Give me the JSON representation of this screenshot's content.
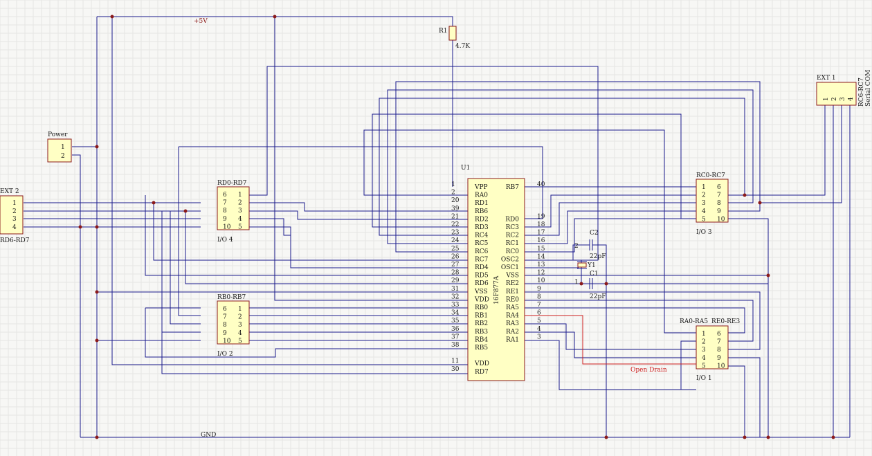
{
  "colors": {
    "wire": "#1a1a8c",
    "wire_alt": "#cc1d1d",
    "part_fill": "#ffffc4",
    "part_border": "#8b1a1a",
    "background": "#f7f7f5"
  },
  "nets": {
    "vcc": "+5V",
    "gnd": "GND",
    "open_drain": "Open Drain"
  },
  "u1": {
    "designator": "U1",
    "part": "16F877A",
    "left_pins": [
      {
        "num": "1",
        "name": "VPP"
      },
      {
        "num": "2",
        "name": "RA0"
      },
      {
        "num": "20",
        "name": "RD1"
      },
      {
        "num": "39",
        "name": "RB6"
      },
      {
        "num": "21",
        "name": "RD2"
      },
      {
        "num": "22",
        "name": "RD3"
      },
      {
        "num": "23",
        "name": "RC4"
      },
      {
        "num": "24",
        "name": "RC5"
      },
      {
        "num": "25",
        "name": "RC6"
      },
      {
        "num": "26",
        "name": "RC7"
      },
      {
        "num": "27",
        "name": "RD4"
      },
      {
        "num": "28",
        "name": "RD5"
      },
      {
        "num": "29",
        "name": "RD6"
      },
      {
        "num": "31",
        "name": "VSS"
      },
      {
        "num": "32",
        "name": "VDD"
      },
      {
        "num": "33",
        "name": "RB0"
      },
      {
        "num": "34",
        "name": "RB1"
      },
      {
        "num": "35",
        "name": "RB2"
      },
      {
        "num": "36",
        "name": "RB3"
      },
      {
        "num": "37",
        "name": "RB4"
      },
      {
        "num": "38",
        "name": "RB5"
      },
      {
        "num": "",
        "name": ""
      },
      {
        "num": "11",
        "name": "VDD"
      },
      {
        "num": "30",
        "name": "RD7"
      }
    ],
    "right_pins": [
      {
        "num": "40",
        "name": "RB7"
      },
      {
        "num": "",
        "name": ""
      },
      {
        "num": "",
        "name": ""
      },
      {
        "num": "",
        "name": ""
      },
      {
        "num": "19",
        "name": "RD0"
      },
      {
        "num": "18",
        "name": "RC3"
      },
      {
        "num": "17",
        "name": "RC2"
      },
      {
        "num": "16",
        "name": "RC1"
      },
      {
        "num": "15",
        "name": "RC0"
      },
      {
        "num": "14",
        "name": "OSC2"
      },
      {
        "num": "13",
        "name": "OSC1"
      },
      {
        "num": "12",
        "name": "VSS"
      },
      {
        "num": "10",
        "name": "RE2"
      },
      {
        "num": "9",
        "name": "RE1"
      },
      {
        "num": "8",
        "name": "RE0"
      },
      {
        "num": "7",
        "name": "RA5"
      },
      {
        "num": "6",
        "name": "RA4"
      },
      {
        "num": "5",
        "name": "RA3"
      },
      {
        "num": "4",
        "name": "RA2"
      },
      {
        "num": "3",
        "name": "RA1"
      }
    ]
  },
  "r1": {
    "designator": "R1",
    "value": "4.7K"
  },
  "c1": {
    "designator": "C1",
    "value": "22pF"
  },
  "c2": {
    "designator": "C2",
    "value": "22pF"
  },
  "y1": {
    "designator": "Y1",
    "pin1": "1",
    "pin2": "2"
  },
  "power": {
    "title": "Power",
    "pins": [
      "1",
      "2"
    ]
  },
  "ext2": {
    "title": "EXT 2",
    "pins": [
      "1",
      "2",
      "3",
      "4"
    ],
    "caption": "RD6-RD7"
  },
  "ext1": {
    "title": "EXT 1",
    "pins": [
      "1",
      "2",
      "3",
      "4"
    ],
    "caption1": "RC6-RC7",
    "caption2": "Serial COM"
  },
  "io4": {
    "title": "RD0-RD7",
    "left": [
      "6",
      "7",
      "8",
      "9",
      "10"
    ],
    "right": [
      "1",
      "2",
      "3",
      "4",
      "5"
    ],
    "caption": "I/O 4"
  },
  "io2": {
    "title": "RB0-RB7",
    "left": [
      "6",
      "7",
      "8",
      "9",
      "10"
    ],
    "right": [
      "1",
      "2",
      "3",
      "4",
      "5"
    ],
    "caption": "I/O 2"
  },
  "io3": {
    "title": "RC0-RC7",
    "left": [
      "1",
      "2",
      "3",
      "4",
      "5"
    ],
    "right": [
      "6",
      "7",
      "8",
      "9",
      "10"
    ],
    "caption": "I/O 3"
  },
  "io1": {
    "title1": "RA0-RA5",
    "title2": "RE0-RE3",
    "left": [
      "1",
      "2",
      "3",
      "4",
      "5"
    ],
    "right": [
      "6",
      "7",
      "8",
      "9",
      "10"
    ],
    "caption": "I/O 1"
  }
}
